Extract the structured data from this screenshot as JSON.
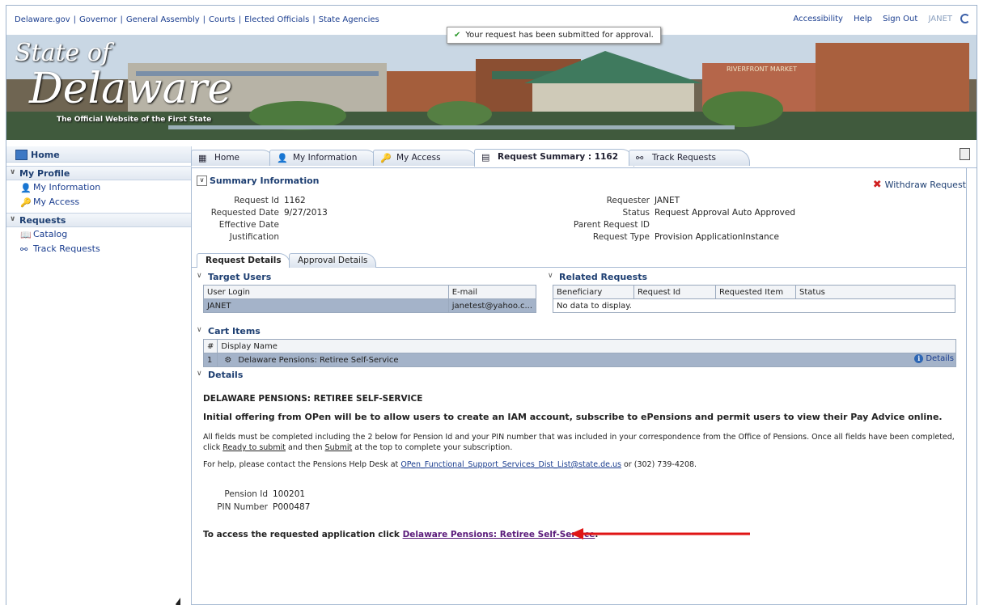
{
  "top_links": [
    "Delaware.gov",
    "Governor",
    "General Assembly",
    "Courts",
    "Elected Officials",
    "State Agencies"
  ],
  "top_right": {
    "accessibility": "Accessibility",
    "help": "Help",
    "sign_out": "Sign Out",
    "user": "JANET"
  },
  "flash": {
    "message": "Your request has been submitted for approval."
  },
  "banner": {
    "line1": "State of",
    "line2": "Delaware",
    "tagline": "The Official Website of the First State"
  },
  "nav": {
    "home": "Home",
    "my_profile": "My Profile",
    "my_information": "My Information",
    "my_access": "My Access",
    "requests": "Requests",
    "catalog": "Catalog",
    "track_requests": "Track Requests"
  },
  "tabs": [
    "Home",
    "My Information",
    "My Access",
    "Request Summary : 1162",
    "Track Requests"
  ],
  "summary": {
    "title": "Summary Information",
    "withdraw": "Withdraw Request",
    "left": [
      {
        "label": "Request Id",
        "value": "1162"
      },
      {
        "label": "Requested Date",
        "value": "9/27/2013"
      },
      {
        "label": "Effective Date",
        "value": ""
      },
      {
        "label": "Justification",
        "value": ""
      }
    ],
    "right": [
      {
        "label": "Requester",
        "value": "JANET"
      },
      {
        "label": "Status",
        "value": "Request Approval Auto Approved"
      },
      {
        "label": "Parent Request ID",
        "value": ""
      },
      {
        "label": "Request Type",
        "value": "Provision ApplicationInstance"
      }
    ]
  },
  "subtabs": [
    "Request Details",
    "Approval Details"
  ],
  "target_users": {
    "title": "Target Users",
    "headers": [
      "User Login",
      "E-mail"
    ],
    "rows": [
      [
        "JANET",
        "janetest@yahoo.c..."
      ]
    ]
  },
  "related_requests": {
    "title": "Related Requests",
    "headers": [
      "Beneficiary",
      "Request Id",
      "Requested Item",
      "Status"
    ],
    "empty": "No data to display."
  },
  "cart_items": {
    "title": "Cart Items",
    "headers": [
      "#",
      "Display Name"
    ],
    "rows": [
      {
        "num": "1",
        "name": "Delaware Pensions: Retiree Self-Service",
        "details": "Details"
      }
    ]
  },
  "details": {
    "title": "Details",
    "heading": "DELAWARE PENSIONS: RETIREE SELF-SERVICE",
    "intro": "Initial offering from OPen will be to allow users to create an IAM account, subscribe to ePensions and permit users to view their Pay Advice online.",
    "p1_a": "All fields must be completed including the 2 below for Pension Id and your PIN number that was included in your correspondence from the Office of Pensions. Once all fields have been completed,",
    "p1_b": "click",
    "ready": "Ready to submit",
    "and_then": "and then",
    "submit": "Submit",
    "p1_c": "at the top to complete your subscription.",
    "help_a": "For help, please contact the Pensions Help Desk at",
    "help_link": "OPen_Functional_Support_Services_Dist_List@state.de.us",
    "help_b": "or (302) 739-4208.",
    "pension_label": "Pension Id",
    "pension_value": "100201",
    "pin_label": "PIN Number",
    "pin_value": "P000487",
    "access_text": "To access the requested application click",
    "access_link": "Delaware Pensions: Retiree Self-Service",
    "access_end": "."
  },
  "colors": {
    "arrow": "#e01515",
    "accent": "#1e3f72",
    "selected_row": "#a4b3c9"
  }
}
